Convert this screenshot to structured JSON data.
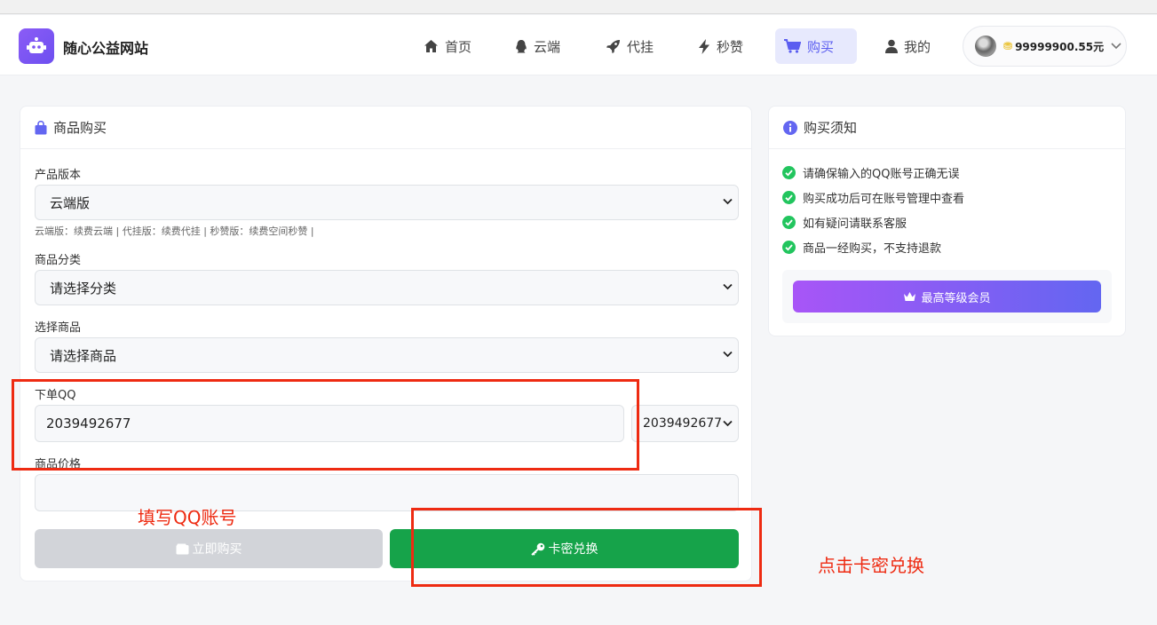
{
  "brand": {
    "name": "随心公益网站"
  },
  "nav": {
    "items": [
      {
        "label": "首页",
        "icon": "home-icon"
      },
      {
        "label": "云端",
        "icon": "qq-icon"
      },
      {
        "label": "代挂",
        "icon": "rocket-icon"
      },
      {
        "label": "秒赞",
        "icon": "bolt-icon"
      },
      {
        "label": "购买",
        "icon": "cart-icon",
        "active": true
      },
      {
        "label": "我的",
        "icon": "user-icon"
      }
    ]
  },
  "user": {
    "balance": "99999900.55元"
  },
  "purchase": {
    "title": "商品购买",
    "version_label": "产品版本",
    "version_value": "云端版",
    "version_hint": "云端版：续费云端 | 代挂版：续费代挂 | 秒赞版：续费空间秒赞 |",
    "category_label": "商品分类",
    "category_value": "请选择分类",
    "product_label": "选择商品",
    "product_value": "请选择商品",
    "qq_label": "下单QQ",
    "qq_value": "2039492677",
    "qq_select_value": "2039492677",
    "price_label": "商品价格",
    "price_value": "",
    "buy_button": "立即购买",
    "redeem_button": "卡密兑换"
  },
  "notice": {
    "title": "购买须知",
    "items": [
      "请确保输入的QQ账号正确无误",
      "购买成功后可在账号管理中查看",
      "如有疑问请联系客服",
      "商品一经购买，不支持退款"
    ],
    "vip_button": "最高等级会员"
  },
  "annotations": {
    "fill_qq": "填写QQ账号",
    "click_redeem": "点击卡密兑换"
  },
  "colors": {
    "accent": "#5b5ef0",
    "buy_disabled": "#d2d4d9",
    "redeem_green": "#16a34a",
    "annotation_red": "#ee2b12",
    "check_green": "#22c55e"
  }
}
